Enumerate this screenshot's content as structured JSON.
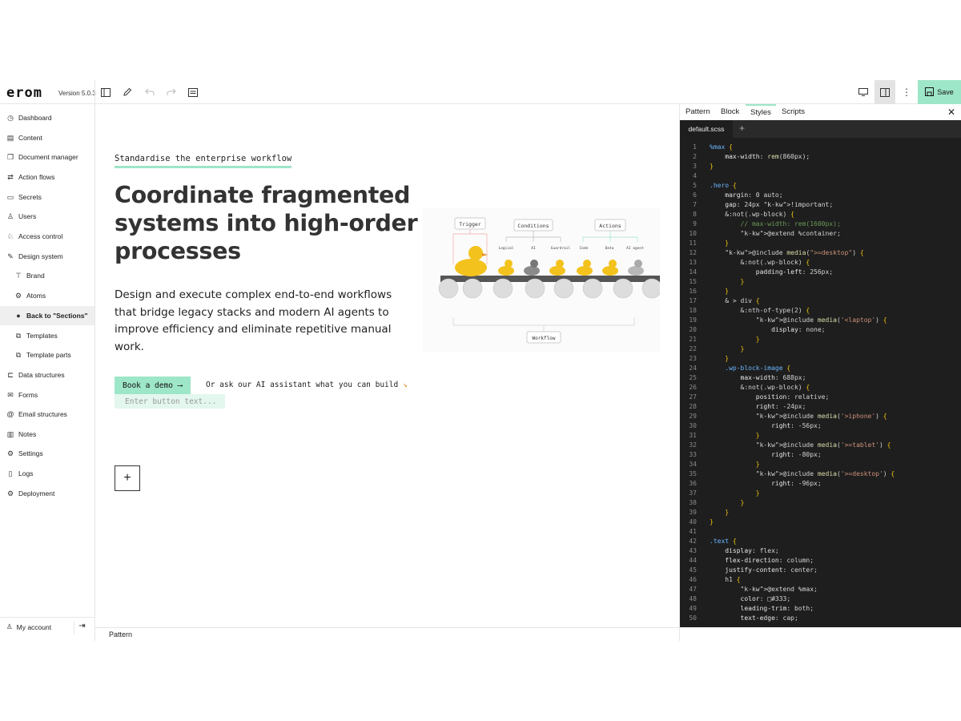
{
  "app": {
    "logo": "erom",
    "version": "Version 5.0.3",
    "save_label": "Save"
  },
  "sidebar": {
    "items": [
      {
        "label": "Dashboard",
        "icon": "clock-icon"
      },
      {
        "label": "Content",
        "icon": "content-icon"
      },
      {
        "label": "Document manager",
        "icon": "document-icon"
      },
      {
        "label": "Action flows",
        "icon": "arrows-icon"
      },
      {
        "label": "Secrets",
        "icon": "folder-lock-icon"
      },
      {
        "label": "Users",
        "icon": "user-icon"
      },
      {
        "label": "Access control",
        "icon": "access-icon"
      },
      {
        "label": "Design system",
        "icon": "design-icon"
      },
      {
        "label": "Brand",
        "icon": "paint-roller-icon"
      },
      {
        "label": "Atoms",
        "icon": "atom-icon"
      },
      {
        "label": "Back to \"Sections\"",
        "icon": "back-circle-icon"
      },
      {
        "label": "Templates",
        "icon": "template-icon"
      },
      {
        "label": "Template parts",
        "icon": "template-parts-icon"
      },
      {
        "label": "Data structures",
        "icon": "data-icon"
      },
      {
        "label": "Forms",
        "icon": "mail-icon"
      },
      {
        "label": "Email structures",
        "icon": "at-icon"
      },
      {
        "label": "Notes",
        "icon": "notes-icon"
      },
      {
        "label": "Settings",
        "icon": "gear-icon"
      },
      {
        "label": "Logs",
        "icon": "file-icon"
      },
      {
        "label": "Deployment",
        "icon": "gear-icon"
      }
    ],
    "account_label": "My account"
  },
  "hero": {
    "eyebrow": "Standardise the enterprise workflow",
    "headline": "Coordinate fragmented systems into high-order processes",
    "body": "Design and execute complex end-to-end workflows that bridge legacy stacks and modern AI agents to improve efficiency and eliminate repetitive manual work.",
    "cta_label": "Book a demo",
    "cta_alt": "Or ask our AI assistant what you can build",
    "button_input_placeholder": "Enter button text...",
    "illustration": {
      "trigger": "Trigger",
      "conditions": "Conditions",
      "actions": "Actions",
      "logical": "Logical",
      "ai": "AI",
      "guardrail": "Guardrail",
      "code": "Code",
      "data": "Data",
      "ai_agent": "AI agent",
      "workflow": "Workflow"
    }
  },
  "statusbar": {
    "label": "Pattern"
  },
  "panel": {
    "tabs": [
      "Pattern",
      "Block",
      "Styles",
      "Scripts"
    ],
    "active_tab": "Styles",
    "file_tab": "default.scss"
  },
  "code_lines": [
    "%max {",
    "    max-width: rem(860px);",
    "}",
    "",
    ".hero {",
    "    margin: 0 auto;",
    "    gap: 24px !important;",
    "    &:not(.wp-block) {",
    "        // max-width: rem(1600px);",
    "        @extend %container;",
    "    }",
    "    @include media(\">=desktop\") {",
    "        &:not(.wp-block) {",
    "            padding-left: 256px;",
    "        }",
    "    }",
    "    & > div {",
    "        &:nth-of-type(2) {",
    "            @include media('<laptop') {",
    "                display: none;",
    "            }",
    "        }",
    "    }",
    "    .wp-block-image {",
    "        max-width: 688px;",
    "        &:not(.wp-block) {",
    "            position: relative;",
    "            right: -24px;",
    "            @include media('>iphone') {",
    "                right: -56px;",
    "            }",
    "            @include media('>=tablet') {",
    "                right: -80px;",
    "            }",
    "            @include media('>=desktop') {",
    "                right: -96px;",
    "            }",
    "        }",
    "    }",
    "}",
    "",
    ".text {",
    "    display: flex;",
    "    flex-direction: column;",
    "    justify-content: center;",
    "    h1 {",
    "        @extend %max;",
    "        color: □#333;",
    "        leading-trim: both;",
    "        text-edge: cap;"
  ]
}
